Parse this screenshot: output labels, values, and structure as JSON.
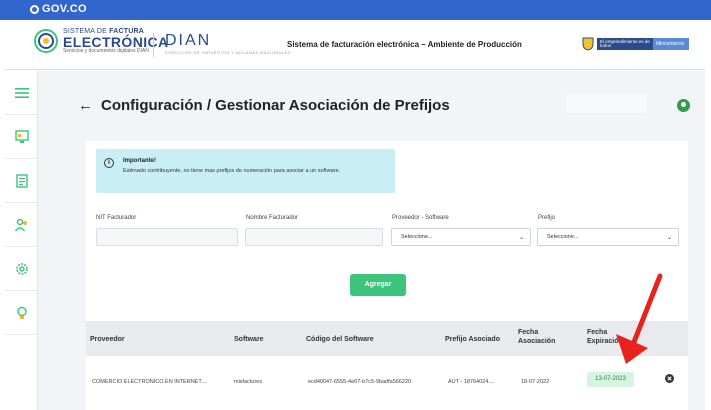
{
  "gov_bar": {
    "logo": "GOV.CO"
  },
  "header": {
    "logo_line1_a": "SISTEMA DE ",
    "logo_line1_b": "FACTURA",
    "logo_line2": "ELECTRÓNICA",
    "logo_line3": "Servicios y documentos digitales DIAN",
    "dian": "DIAN",
    "dian_sub": "DIRECCIÓN DE IMPUESTOS Y ADUANAS NACIONALES",
    "system_title": "Sistema de facturación electrónica – Ambiente de Producción",
    "badge_1": "El emprendimiento es de todos",
    "badge_2": "Mincomercio"
  },
  "page": {
    "title": "Configuración / Gestionar Asociación de Prefijos"
  },
  "alert": {
    "title": "Importante!",
    "text": "Estimado contribuyente, no tiene mas prefijos de numeración para asociar a un software."
  },
  "form": {
    "nit_label": "NIT Facturador",
    "nit_value": "",
    "nombre_label": "Nombre Facturador",
    "nombre_value": "",
    "proveedor_label": "Proveedor - Software",
    "proveedor_value": "Seleccione...",
    "prefijo_label": "Prefijo",
    "prefijo_value": "Seleccione...",
    "agregar_label": "Agregar"
  },
  "table": {
    "headers": {
      "proveedor": "Proveedor",
      "software": "Software",
      "codigo": "Código del Software",
      "prefijo": "Prefijo Asociado",
      "fecha_asoc_1": "Fecha",
      "fecha_asoc_2": "Asociación",
      "fecha_exp_1": "Fecha",
      "fecha_exp_2": "Expiración"
    },
    "rows": [
      {
        "proveedor": "COMERCIO ELECTRONICO EN INTERNET....",
        "software": "misfactures",
        "codigo": "ecd40047-6555-4e67-b7c5-9badfa566220",
        "prefijo": "AUT - 18764024....",
        "fecha_asociacion": "18-07-2022",
        "fecha_expiracion": "13-07-2023"
      }
    ]
  },
  "colors": {
    "gov_blue": "#3366cc",
    "brand_navy": "#2a4c8c",
    "agregar_green": "#3cc47c",
    "expiration_badge": "#d6f5e0",
    "annotation_arrow": "#e8231e"
  }
}
